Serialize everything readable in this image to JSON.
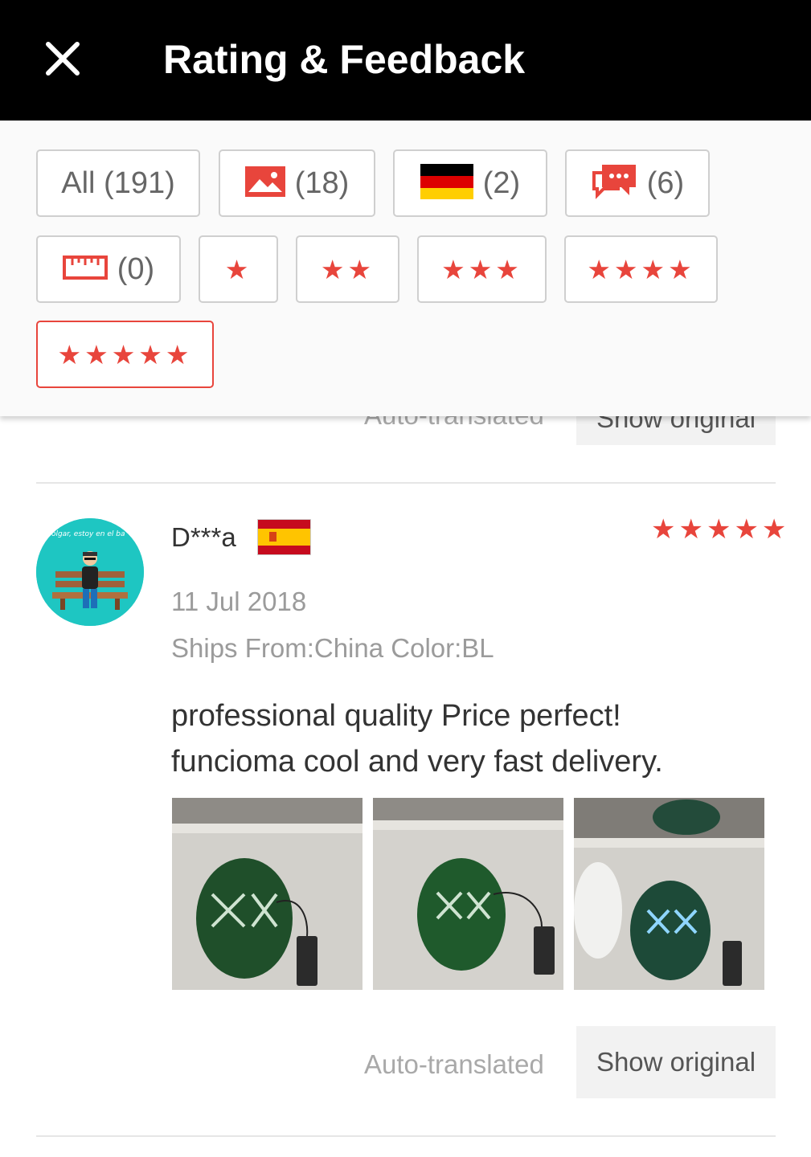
{
  "header": {
    "title": "Rating & Feedback"
  },
  "filters": {
    "all_label": "All (191)",
    "photo_count": "(18)",
    "country_count": "(2)",
    "comment_count": "(6)",
    "size_count": "(0)",
    "star_chips": [
      "★",
      "★★",
      "★★★",
      "★★★★",
      "★★★★★"
    ],
    "active_filter": "5 stars"
  },
  "previous_review": {
    "auto_translated": "Auto-translated",
    "show_original": "Show original"
  },
  "review": {
    "avatar_caption": "colgar, estoy en el ba",
    "name": "D***a",
    "country_flag": "Spain",
    "rating_stars": "★★★★★",
    "rating": 5,
    "date": "11 Jul 2018",
    "meta": "Ships From:China Color:BL",
    "text_line1": "professional quality Price perfect!",
    "text_line2": "funcioma cool and very fast delivery.",
    "photo_count": 3,
    "auto_translated": "Auto-translated",
    "show_original": "Show original"
  },
  "colors": {
    "accent": "#e8453c",
    "header_bg": "#000000",
    "avatar_bg": "#1ec6c2"
  }
}
